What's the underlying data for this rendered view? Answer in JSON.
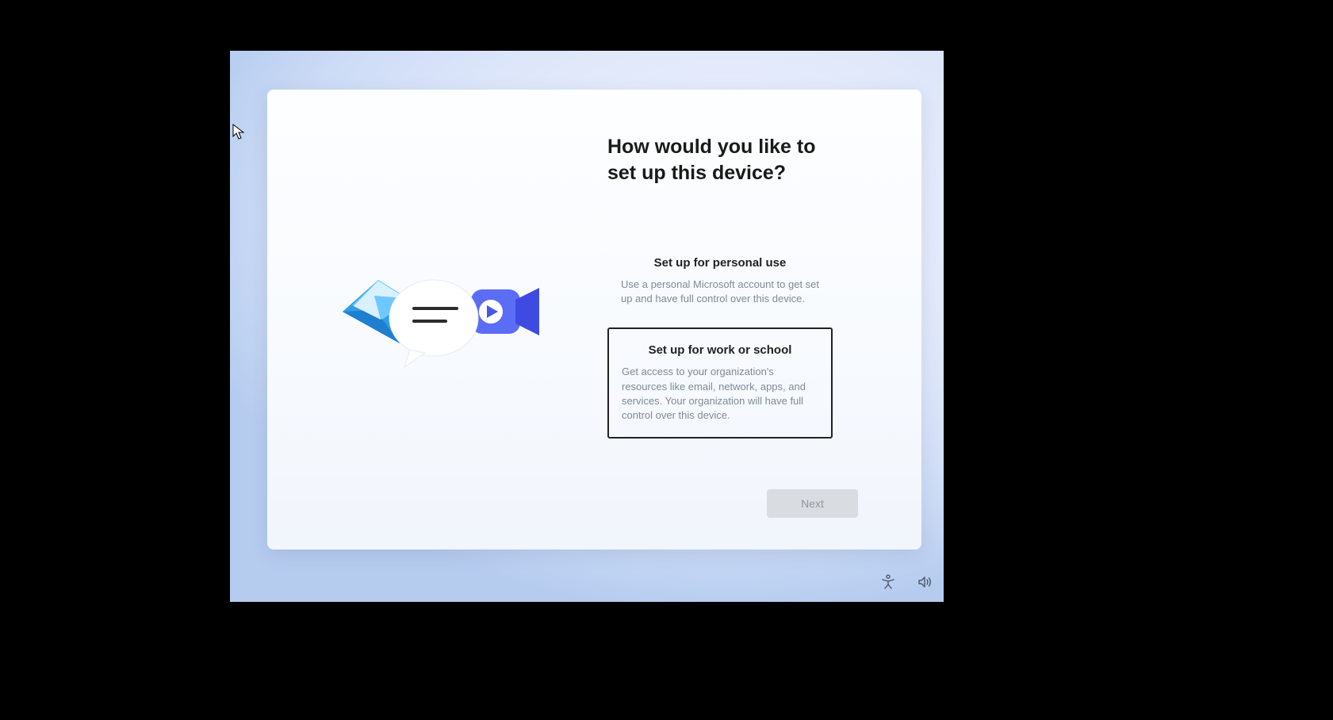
{
  "title": "How would you like to set up this device?",
  "options": [
    {
      "title": "Set up for personal use",
      "desc": "Use a personal Microsoft account to get set up and have full control over this device.",
      "selected": false
    },
    {
      "title": "Set up for work or school",
      "desc": "Get access to your organization's resources like email, network, apps, and services. Your organization will have full control over this device.",
      "selected": true
    }
  ],
  "next_label": "Next"
}
